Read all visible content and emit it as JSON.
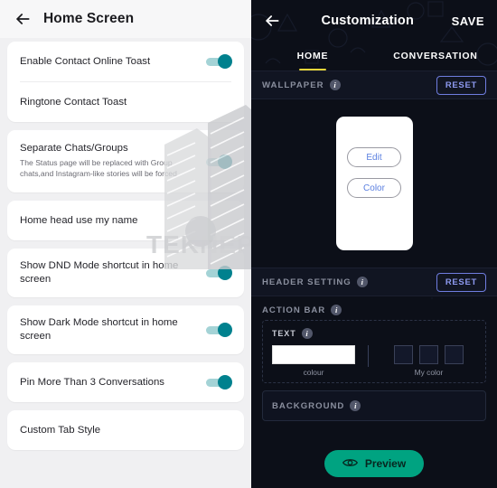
{
  "left_panel": {
    "header": {
      "back_icon": "back-arrow-icon",
      "title": "Home Screen"
    },
    "cards": [
      {
        "rows": [
          {
            "label": "Enable Contact Online Toast",
            "sub": "",
            "toggle": true,
            "toggle_on": true
          },
          {
            "label": "Ringtone Contact Toast",
            "sub": "",
            "toggle": false,
            "toggle_on": false
          }
        ]
      },
      {
        "rows": [
          {
            "label": "Separate Chats/Groups",
            "sub": "The Status page will be replaced with Group chats,and Instagram-like stories will be forced",
            "toggle": true,
            "toggle_on": true
          }
        ]
      },
      {
        "rows": [
          {
            "label": "Home head use my name",
            "sub": "",
            "toggle": false,
            "toggle_on": false
          }
        ]
      },
      {
        "rows": [
          {
            "label": "Show DND Mode shortcut in home screen",
            "sub": "",
            "toggle": true,
            "toggle_on": true
          }
        ]
      },
      {
        "rows": [
          {
            "label": "Show Dark Mode shortcut in home screen",
            "sub": "",
            "toggle": true,
            "toggle_on": true
          }
        ]
      },
      {
        "rows": [
          {
            "label": "Pin More Than 3 Conversations",
            "sub": "",
            "toggle": true,
            "toggle_on": true
          }
        ]
      },
      {
        "rows": [
          {
            "label": "Custom Tab Style",
            "sub": "",
            "toggle": false,
            "toggle_on": false
          }
        ]
      }
    ],
    "watermark_text": "TEKNEPOLIS"
  },
  "right_panel": {
    "header": {
      "back_icon": "back-arrow-icon",
      "title": "Customization",
      "save_label": "SAVE"
    },
    "tabs": [
      {
        "label": "HOME",
        "active": true
      },
      {
        "label": "CONVERSATION",
        "active": false
      }
    ],
    "wallpaper": {
      "section_title": "WALLPAPER",
      "info_glyph": "i",
      "reset_label": "RESET",
      "edit_label": "Edit",
      "color_label": "Color"
    },
    "header_setting": {
      "section_title": "HEADER SETTING",
      "info_glyph": "i",
      "reset_label": "RESET"
    },
    "action_bar": {
      "section_title": "ACTION BAR",
      "info_glyph": "i",
      "text": {
        "label": "TEXT",
        "info_glyph": "i",
        "colour_caption": "colour",
        "colour_value": "#ffffff",
        "mycolor_caption": "My color",
        "mycolor_values": [
          "#13182a",
          "#13182a",
          "#13182a"
        ]
      }
    },
    "background": {
      "section_title": "BACKGROUND",
      "info_glyph": "i"
    },
    "preview": {
      "label": "Preview",
      "icon": "eye-icon"
    },
    "colors": {
      "panel_bg": "#0c0f18",
      "tab_accent": "#e8d63a",
      "reset_border": "#6f7de0",
      "preview_bg": "#00a381"
    }
  }
}
